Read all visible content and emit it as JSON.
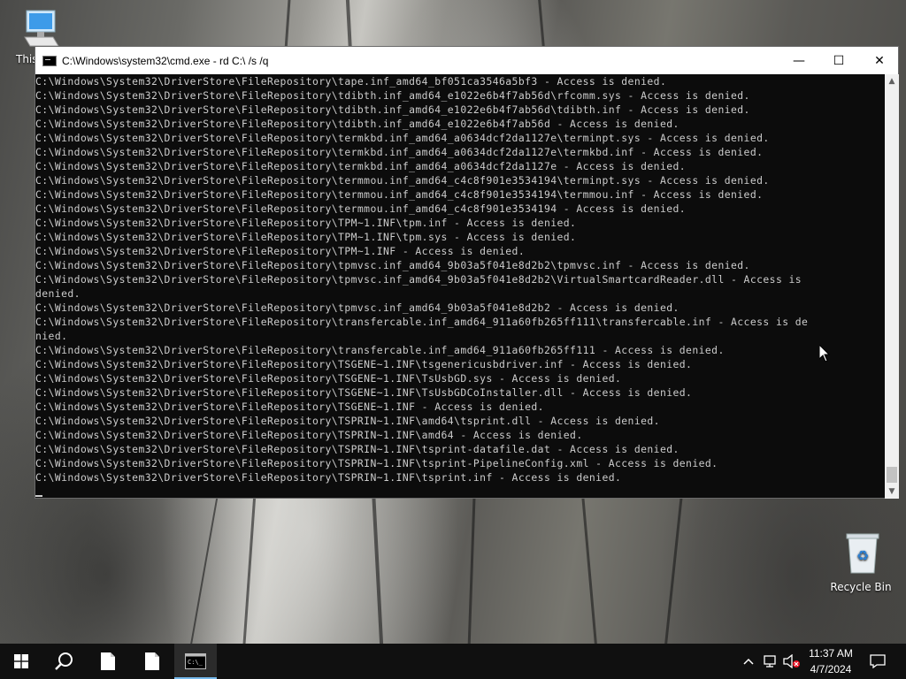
{
  "desktop": {
    "this_pc_label": "This",
    "recycle_bin_label": "Recycle Bin"
  },
  "window": {
    "title": "C:\\Windows\\system32\\cmd.exe - rd  C:\\ /s /q",
    "minimize_glyph": "—",
    "maximize_glyph": "☐",
    "close_glyph": "✕"
  },
  "console": {
    "lines": [
      "C:\\Windows\\System32\\DriverStore\\FileRepository\\tape.inf_amd64_bf051ca3546a5bf3 - Access is denied.",
      "C:\\Windows\\System32\\DriverStore\\FileRepository\\tdibth.inf_amd64_e1022e6b4f7ab56d\\rfcomm.sys - Access is denied.",
      "C:\\Windows\\System32\\DriverStore\\FileRepository\\tdibth.inf_amd64_e1022e6b4f7ab56d\\tdibth.inf - Access is denied.",
      "C:\\Windows\\System32\\DriverStore\\FileRepository\\tdibth.inf_amd64_e1022e6b4f7ab56d - Access is denied.",
      "C:\\Windows\\System32\\DriverStore\\FileRepository\\termkbd.inf_amd64_a0634dcf2da1127e\\terminpt.sys - Access is denied.",
      "C:\\Windows\\System32\\DriverStore\\FileRepository\\termkbd.inf_amd64_a0634dcf2da1127e\\termkbd.inf - Access is denied.",
      "C:\\Windows\\System32\\DriverStore\\FileRepository\\termkbd.inf_amd64_a0634dcf2da1127e - Access is denied.",
      "C:\\Windows\\System32\\DriverStore\\FileRepository\\termmou.inf_amd64_c4c8f901e3534194\\terminpt.sys - Access is denied.",
      "C:\\Windows\\System32\\DriverStore\\FileRepository\\termmou.inf_amd64_c4c8f901e3534194\\termmou.inf - Access is denied.",
      "C:\\Windows\\System32\\DriverStore\\FileRepository\\termmou.inf_amd64_c4c8f901e3534194 - Access is denied.",
      "C:\\Windows\\System32\\DriverStore\\FileRepository\\TPM~1.INF\\tpm.inf - Access is denied.",
      "C:\\Windows\\System32\\DriverStore\\FileRepository\\TPM~1.INF\\tpm.sys - Access is denied.",
      "C:\\Windows\\System32\\DriverStore\\FileRepository\\TPM~1.INF - Access is denied.",
      "C:\\Windows\\System32\\DriverStore\\FileRepository\\tpmvsc.inf_amd64_9b03a5f041e8d2b2\\tpmvsc.inf - Access is denied.",
      "C:\\Windows\\System32\\DriverStore\\FileRepository\\tpmvsc.inf_amd64_9b03a5f041e8d2b2\\VirtualSmartcardReader.dll - Access is",
      "denied.",
      "C:\\Windows\\System32\\DriverStore\\FileRepository\\tpmvsc.inf_amd64_9b03a5f041e8d2b2 - Access is denied.",
      "C:\\Windows\\System32\\DriverStore\\FileRepository\\transfercable.inf_amd64_911a60fb265ff111\\transfercable.inf - Access is de",
      "nied.",
      "C:\\Windows\\System32\\DriverStore\\FileRepository\\transfercable.inf_amd64_911a60fb265ff111 - Access is denied.",
      "C:\\Windows\\System32\\DriverStore\\FileRepository\\TSGENE~1.INF\\tsgenericusbdriver.inf - Access is denied.",
      "C:\\Windows\\System32\\DriverStore\\FileRepository\\TSGENE~1.INF\\TsUsbGD.sys - Access is denied.",
      "C:\\Windows\\System32\\DriverStore\\FileRepository\\TSGENE~1.INF\\TsUsbGDCoInstaller.dll - Access is denied.",
      "C:\\Windows\\System32\\DriverStore\\FileRepository\\TSGENE~1.INF - Access is denied.",
      "C:\\Windows\\System32\\DriverStore\\FileRepository\\TSPRIN~1.INF\\amd64\\tsprint.dll - Access is denied.",
      "C:\\Windows\\System32\\DriverStore\\FileRepository\\TSPRIN~1.INF\\amd64 - Access is denied.",
      "C:\\Windows\\System32\\DriverStore\\FileRepository\\TSPRIN~1.INF\\tsprint-datafile.dat - Access is denied.",
      "C:\\Windows\\System32\\DriverStore\\FileRepository\\TSPRIN~1.INF\\tsprint-PipelineConfig.xml - Access is denied.",
      "C:\\Windows\\System32\\DriverStore\\FileRepository\\TSPRIN~1.INF\\tsprint.inf - Access is denied."
    ]
  },
  "taskbar": {
    "clock_time": "11:37 AM",
    "clock_date": "4/7/2024"
  },
  "colors": {
    "console_bg": "#0c0c0c",
    "console_text": "#cccccc",
    "taskbar_bg": "#101010",
    "active_indicator": "#76b9ed"
  }
}
